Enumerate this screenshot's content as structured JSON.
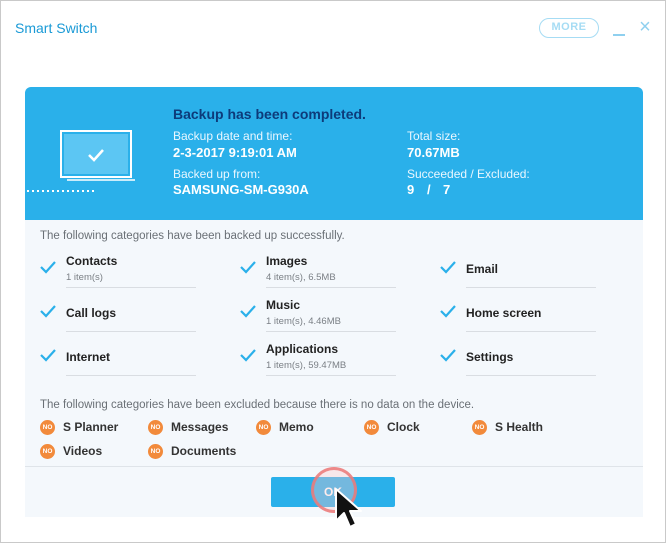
{
  "window": {
    "title": "Smart Switch",
    "more_label": "MORE",
    "minimize_icon": "minimize-icon",
    "close_icon": "close-icon"
  },
  "banner": {
    "headline": "Backup has been completed.",
    "backup_date_label": "Backup date and time:",
    "backup_date_value": "2-3-2017 9:19:01 AM",
    "backed_up_from_label": "Backed up from:",
    "backed_up_from_value": "SAMSUNG-SM-G930A",
    "total_size_label": "Total size:",
    "total_size_value": "70.67MB",
    "succeeded_label": "Succeeded / Excluded:",
    "succeeded_value": "9",
    "succeeded_sep": "/",
    "excluded_value": "7",
    "icon": "laptop-check-icon",
    "accent_color": "#2ab0ea"
  },
  "succeeded": {
    "label": "The following categories have been backed up successfully.",
    "items": [
      {
        "name": "Contacts",
        "detail": "1 item(s)"
      },
      {
        "name": "Images",
        "detail": "4 item(s), 6.5MB"
      },
      {
        "name": "Email",
        "detail": ""
      },
      {
        "name": "Call logs",
        "detail": ""
      },
      {
        "name": "Music",
        "detail": "1 item(s), 4.46MB"
      },
      {
        "name": "Home screen",
        "detail": ""
      },
      {
        "name": "Internet",
        "detail": ""
      },
      {
        "name": "Applications",
        "detail": "1 item(s), 59.47MB"
      },
      {
        "name": "Settings",
        "detail": ""
      }
    ]
  },
  "excluded": {
    "label": "The following categories have been excluded because there is no data on the device.",
    "badge": "NO",
    "badge_color": "#f28a3b",
    "items": [
      "S Planner",
      "Messages",
      "Memo",
      "Clock",
      "S Health",
      "Videos",
      "Documents"
    ]
  },
  "footer": {
    "ok_label": "OK"
  }
}
